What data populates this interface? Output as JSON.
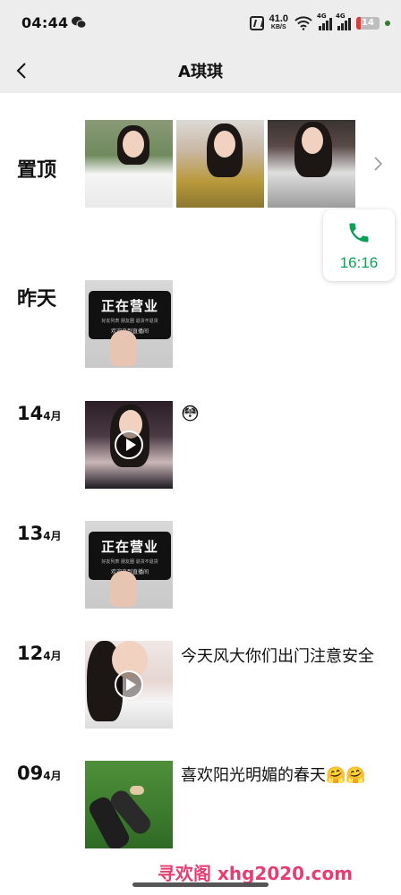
{
  "status_bar": {
    "time": "04:44",
    "net_speed_value": "41.0",
    "net_speed_unit": "KB/S",
    "signal1_label": "4G",
    "signal2_label": "4G",
    "battery": "14"
  },
  "header": {
    "back_icon": "chevron-left-icon",
    "title": "A琪琪"
  },
  "call_float": {
    "icon": "phone-icon",
    "duration": "16:16",
    "color": "#07a253"
  },
  "timeline": {
    "pinned_label": "置顶",
    "yesterday_label": "昨天",
    "posts": [
      {
        "day": "14",
        "month": "4月",
        "type": "video",
        "emoji": "😳"
      },
      {
        "day": "13",
        "month": "4月",
        "type": "image"
      },
      {
        "day": "12",
        "month": "4月",
        "type": "video",
        "text": "今天风大你们出门注意安全"
      },
      {
        "day": "09",
        "month": "4月",
        "type": "image",
        "text": "喜欢阳光明媚的春天🤗🤗"
      }
    ],
    "card_text": {
      "headline": "正在营业",
      "subline": "好友列表  朋友圈  退货不退货",
      "footer": "欢迎来到直播间"
    }
  },
  "watermark": "寻欢阁 xhg2020.com",
  "accent_color": "#e53e70"
}
